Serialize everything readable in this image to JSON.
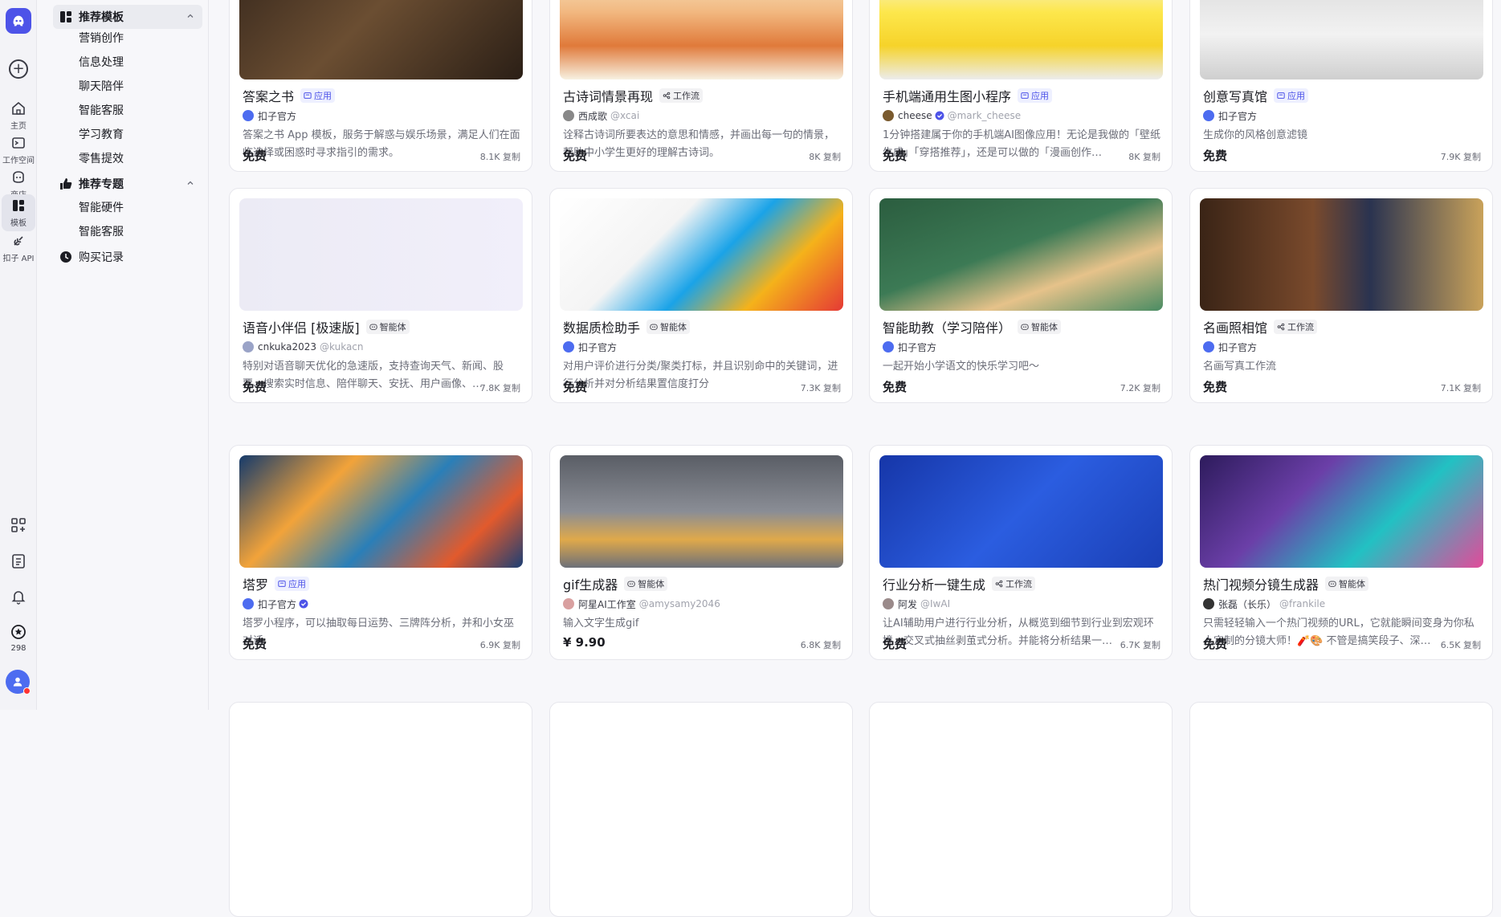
{
  "rail": {
    "items": [
      {
        "label": "主页",
        "icon": "home-icon"
      },
      {
        "label": "工作空间",
        "icon": "workspace-icon"
      },
      {
        "label": "商店",
        "icon": "store-icon"
      },
      {
        "label": "模板",
        "icon": "template-icon"
      },
      {
        "label": "扣子 API",
        "icon": "api-icon"
      }
    ],
    "bottom_count": "298"
  },
  "sidebar": {
    "group1": "推荐模板",
    "group1_items": [
      "营销创作",
      "信息处理",
      "聊天陪伴",
      "智能客服",
      "学习教育",
      "零售提效"
    ],
    "group2": "推荐专题",
    "group2_items": [
      "智能硬件",
      "智能客服"
    ],
    "purchase": "购买记录"
  },
  "cards": [
    {
      "title": "答案之书",
      "tag": "应用",
      "tag_type": "app",
      "author": "扣子官方",
      "handle": "",
      "verified": false,
      "desc": "答案之书 App 模板，服务于解惑与娱乐场景，满足人们在面临选择或困惑时寻求指引的需求。",
      "price": "免费",
      "copies": "8.1K 复制"
    },
    {
      "title": "古诗词情景再现",
      "tag": "工作流",
      "tag_type": "flow",
      "author": "西成歌",
      "handle": "@xcai",
      "verified": false,
      "desc": "诠释古诗词所要表达的意思和情感，并画出每一句的情景，帮助中小学生更好的理解古诗词。",
      "price": "免费",
      "copies": "8K 复制"
    },
    {
      "title": "手机端通用生图小程序",
      "tag": "应用",
      "tag_type": "app",
      "author": "cheese",
      "handle": "@mark_cheese",
      "verified": true,
      "desc": "1分钟搭建属于你的手机端AI图像应用！无论是我做的「壁纸生成」「穿搭推荐」，还是可以做的「漫画创作…",
      "price": "免费",
      "copies": "8K 复制"
    },
    {
      "title": "创意写真馆",
      "tag": "应用",
      "tag_type": "app",
      "author": "扣子官方",
      "handle": "",
      "verified": false,
      "desc": "生成你的风格创意滤镜",
      "price": "免费",
      "copies": "7.9K 复制"
    },
    {
      "title": "语音小伴侣 [极速版]",
      "tag": "智能体",
      "tag_type": "agent",
      "author": "cnkuka2023",
      "handle": "@kukacn",
      "verified": false,
      "desc": "特别对语音聊天优化的急速版，支持查询天气、新闻、股票、搜索实时信息、陪伴聊天、安抚、用户画像、…",
      "price": "免费",
      "copies": "7.8K 复制"
    },
    {
      "title": "数据质检助手",
      "tag": "智能体",
      "tag_type": "agent",
      "author": "扣子官方",
      "handle": "",
      "verified": false,
      "desc": "对用户评价进行分类/聚类打标，并且识别命中的关键词，进行分析并对分析结果置信度打分",
      "price": "免费",
      "copies": "7.3K 复制"
    },
    {
      "title": "智能助教（学习陪伴）",
      "tag": "智能体",
      "tag_type": "agent",
      "author": "扣子官方",
      "handle": "",
      "verified": false,
      "desc": "一起开始小学语文的快乐学习吧～",
      "price": "免费",
      "copies": "7.2K 复制"
    },
    {
      "title": "名画照相馆",
      "tag": "工作流",
      "tag_type": "flow",
      "author": "扣子官方",
      "handle": "",
      "verified": false,
      "desc": "名画写真工作流",
      "price": "免费",
      "copies": "7.1K 复制"
    },
    {
      "title": "塔罗",
      "tag": "应用",
      "tag_type": "app",
      "author": "扣子官方",
      "handle": "",
      "verified": true,
      "desc": "塔罗小程序，可以抽取每日运势、三牌阵分析，并和小女巫对话",
      "price": "免费",
      "copies": "6.9K 复制"
    },
    {
      "title": "gif生成器",
      "tag": "智能体",
      "tag_type": "agent",
      "author": "阿星AI工作室",
      "handle": "@amysamy2046",
      "verified": false,
      "desc": "输入文字生成gif",
      "price": "¥ 9.90",
      "copies": "6.8K 复制"
    },
    {
      "title": "行业分析一键生成",
      "tag": "工作流",
      "tag_type": "flow",
      "author": "阿发",
      "handle": "@IwAI",
      "verified": false,
      "desc": "让AI辅助用户进行行业分析，从概览到细节到行业到宏观环境，交叉式抽丝剥茧式分析。并能将分析结果一…",
      "price": "免费",
      "copies": "6.7K 复制"
    },
    {
      "title": "热门视频分镜生成器",
      "tag": "智能体",
      "tag_type": "agent",
      "author": "张磊（长乐）",
      "handle": "@frankile",
      "verified": false,
      "desc": "只需轻轻输入一个热门视频的URL，它就能瞬间变身为你私人定制的分镜大师！🧨🎨 不管是搞笑段子、深…",
      "price": "免费",
      "copies": "6.5K 复制"
    }
  ],
  "colors": {
    "accent": "#4d53e8",
    "bg": "#f7f7fa"
  }
}
